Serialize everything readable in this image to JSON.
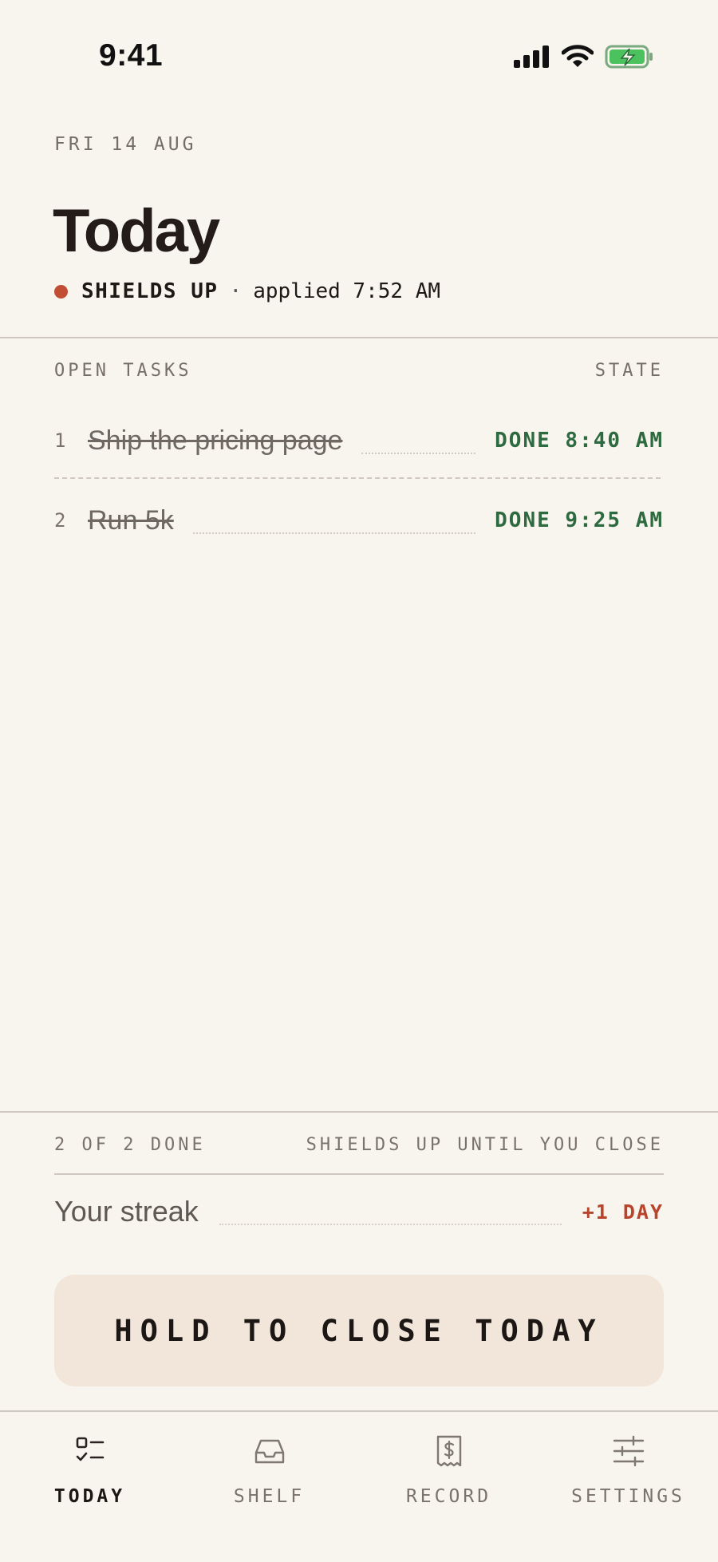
{
  "status_bar": {
    "time": "9:41"
  },
  "header": {
    "date": "FRI 14 AUG",
    "title": "Today",
    "shield_state": "SHIELDS UP",
    "separator": "·",
    "applied": "applied 7:52 AM",
    "shield_color": "#c24d35"
  },
  "tasks_table": {
    "col_tasks": "OPEN TASKS",
    "col_state": "STATE",
    "rows": [
      {
        "num": "1",
        "name": "Ship the pricing page",
        "state": "DONE 8:40 AM"
      },
      {
        "num": "2",
        "name": "Run 5k",
        "state": "DONE 9:25 AM"
      }
    ]
  },
  "footer": {
    "progress": "2 OF 2 DONE",
    "shield_note": "SHIELDS UP UNTIL YOU CLOSE",
    "streak_label": "Your streak",
    "streak_value": "+1 DAY",
    "close_button": "HOLD TO CLOSE TODAY"
  },
  "tabs": [
    {
      "label": "TODAY",
      "icon": "checklist-icon",
      "active": true
    },
    {
      "label": "SHELF",
      "icon": "inbox-tray-icon",
      "active": false
    },
    {
      "label": "RECORD",
      "icon": "receipt-dollar-icon",
      "active": false
    },
    {
      "label": "SETTINGS",
      "icon": "sliders-icon",
      "active": false
    }
  ],
  "colors": {
    "background": "#f8f4ee",
    "done_green": "#2e6a3f",
    "accent_red": "#b9442c",
    "button_bg": "#f1e6d9"
  }
}
